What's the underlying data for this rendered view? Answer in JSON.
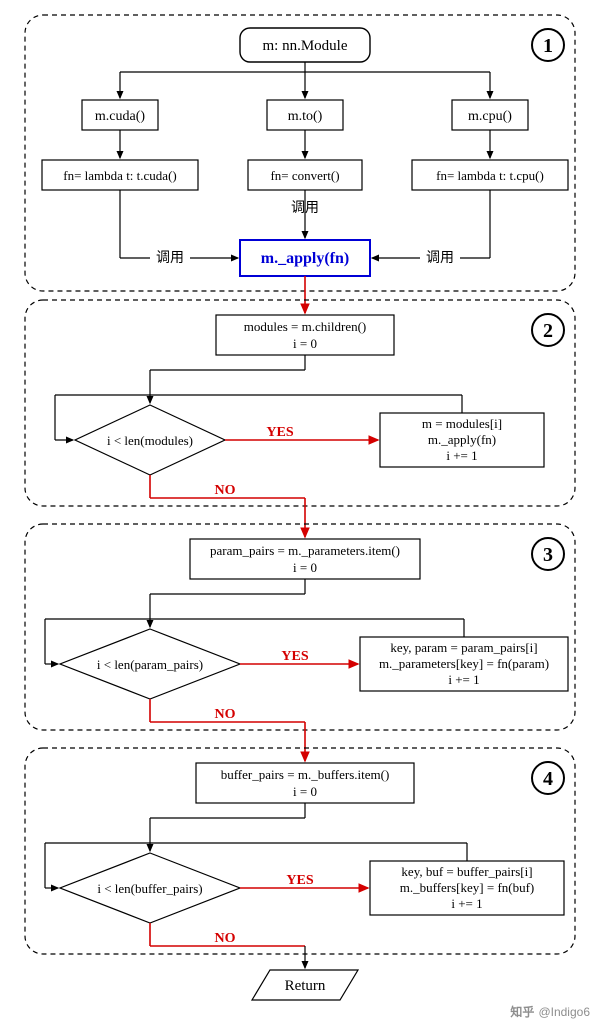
{
  "section1": {
    "number": "1",
    "root": "m: nn.Module",
    "cuda": "m.cuda()",
    "to": "m.to()",
    "cpu": "m.cpu()",
    "fn_cuda": "fn= lambda t: t.cuda()",
    "fn_convert": "fn= convert()",
    "fn_cpu": "fn= lambda t: t.cpu()",
    "call_center": "调用",
    "call_left": "调用",
    "call_right": "调用",
    "apply": "m._apply(fn)"
  },
  "section2": {
    "number": "2",
    "init": "modules = m.children()\ni = 0",
    "cond": "i < len(modules)",
    "yes": "YES",
    "no": "NO",
    "body": "m = modules[i]\nm._apply(fn)\ni += 1"
  },
  "section3": {
    "number": "3",
    "init": "param_pairs = m._parameters.item()\ni = 0",
    "cond": "i < len(param_pairs)",
    "yes": "YES",
    "no": "NO",
    "body": "key, param = param_pairs[i]\nm._parameters[key] = fn(param)\ni += 1"
  },
  "section4": {
    "number": "4",
    "init": "buffer_pairs = m._buffers.item()\ni = 0",
    "cond": "i < len(buffer_pairs)",
    "yes": "YES",
    "no": "NO",
    "body": "key, buf = buffer_pairs[i]\nm._buffers[key] = fn(buf)\ni += 1"
  },
  "return": "Return",
  "watermark": "@Indigo6",
  "watermark_brand": "知乎"
}
